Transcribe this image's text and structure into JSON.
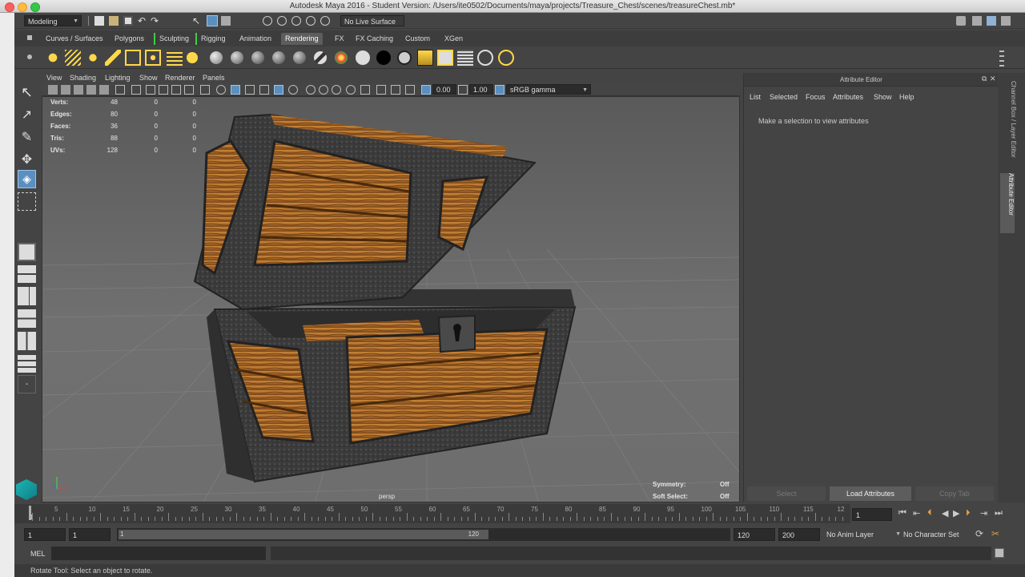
{
  "window": {
    "title": "Autodesk Maya 2016 - Student Version: /Users/ite0502/Documents/maya/projects/Treasure_Chest/scenes/treasureChest.mb*"
  },
  "status_line": {
    "menu_set": "Modeling",
    "live_surface": "No Live Surface"
  },
  "shelf": {
    "tabs": [
      "Curves / Surfaces",
      "Polygons",
      "Sculpting",
      "Rigging",
      "Animation",
      "Rendering",
      "FX",
      "FX Caching",
      "Custom",
      "XGen"
    ],
    "active_tab": "Rendering"
  },
  "viewport": {
    "menu": [
      "View",
      "Shading",
      "Lighting",
      "Show",
      "Renderer",
      "Panels"
    ],
    "exposure": "0.00",
    "gamma": "1.00",
    "color_space": "sRGB gamma",
    "camera_label": "persp",
    "hud": {
      "rows": [
        {
          "label": "Verts:",
          "v1": "48",
          "v2": "0",
          "v3": "0"
        },
        {
          "label": "Edges:",
          "v1": "80",
          "v2": "0",
          "v3": "0"
        },
        {
          "label": "Faces:",
          "v1": "36",
          "v2": "0",
          "v3": "0"
        },
        {
          "label": "Tris:",
          "v1": "88",
          "v2": "0",
          "v3": "0"
        },
        {
          "label": "UVs:",
          "v1": "128",
          "v2": "0",
          "v3": "0"
        }
      ],
      "symmetry_label": "Symmetry:",
      "symmetry_value": "Off",
      "soft_select_label": "Soft Select:",
      "soft_select_value": "Off"
    }
  },
  "attribute_editor": {
    "title": "Attribute Editor",
    "menu": [
      "List",
      "Selected",
      "Focus",
      "Attributes",
      "Show",
      "Help"
    ],
    "message": "Make a selection to view attributes",
    "buttons": {
      "select": "Select",
      "load": "Load Attributes",
      "copy": "Copy Tab"
    },
    "side_tabs": {
      "channel_box": "Channel Box / Layer Editor",
      "attribute_editor": "Attribute Editor"
    }
  },
  "timeline": {
    "ticks": [
      "1",
      "5",
      "10",
      "15",
      "20",
      "25",
      "30",
      "35",
      "40",
      "45",
      "50",
      "55",
      "60",
      "65",
      "70",
      "75",
      "80",
      "85",
      "90",
      "95",
      "100",
      "105",
      "110",
      "115",
      "12"
    ],
    "current_frame": "1"
  },
  "range": {
    "start": "1",
    "playback_start": "1",
    "slider_start": "1",
    "slider_end": "120",
    "playback_end": "120",
    "end": "200",
    "anim_layer": "No Anim Layer",
    "character_set": "No Character Set"
  },
  "command_line": {
    "label": "MEL"
  },
  "help_line": {
    "text": "Rotate Tool: Select an object to rotate."
  }
}
